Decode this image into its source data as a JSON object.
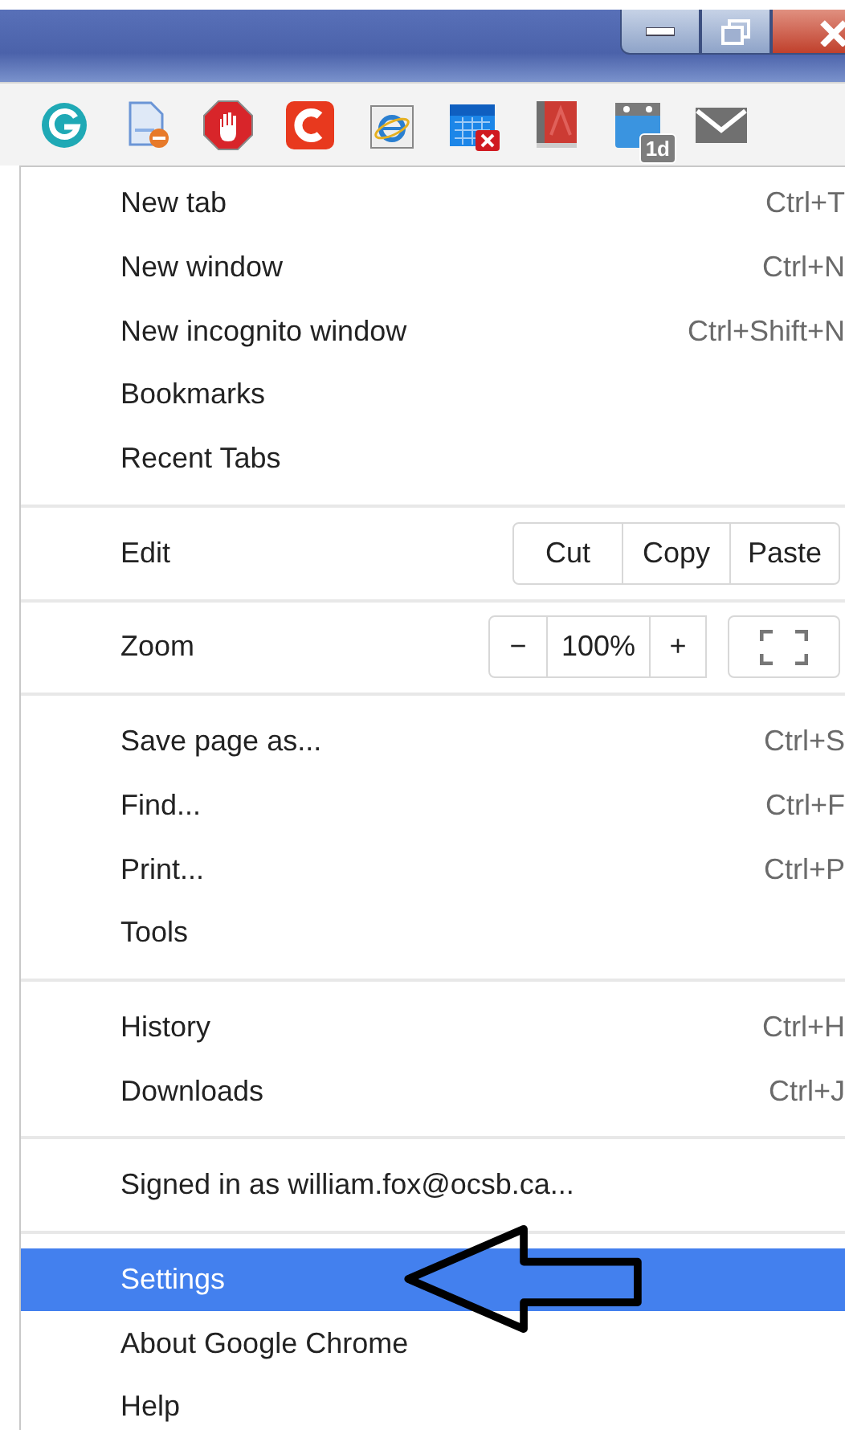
{
  "toolbar": {
    "calendar_badge": "1d"
  },
  "menu": {
    "sections": [
      {
        "items": [
          {
            "kind": "item",
            "label": "New tab",
            "shortcut": "Ctrl+T",
            "selected": false
          },
          {
            "kind": "item",
            "label": "New window",
            "shortcut": "Ctrl+N",
            "selected": false
          },
          {
            "kind": "item",
            "label": "New incognito window",
            "shortcut": "Ctrl+Shift+N",
            "selected": false
          },
          {
            "kind": "item",
            "label": "Bookmarks",
            "selected": false
          },
          {
            "kind": "item",
            "label": "Recent Tabs",
            "selected": false
          }
        ]
      },
      {
        "items": [
          {
            "kind": "edit",
            "label": "Edit",
            "buttons": [
              "Cut",
              "Copy",
              "Paste"
            ],
            "selected": false
          }
        ]
      },
      {
        "items": [
          {
            "kind": "zoom",
            "label": "Zoom",
            "minus": "−",
            "value": "100%",
            "plus": "+",
            "selected": false
          }
        ]
      },
      {
        "items": [
          {
            "kind": "item",
            "label": "Save page as...",
            "shortcut": "Ctrl+S",
            "selected": false
          },
          {
            "kind": "item",
            "label": "Find...",
            "shortcut": "Ctrl+F",
            "selected": false
          },
          {
            "kind": "item",
            "label": "Print...",
            "shortcut": "Ctrl+P",
            "selected": false
          },
          {
            "kind": "item",
            "label": "Tools",
            "selected": false
          }
        ]
      },
      {
        "items": [
          {
            "kind": "item",
            "label": "History",
            "shortcut": "Ctrl+H",
            "selected": false
          },
          {
            "kind": "item",
            "label": "Downloads",
            "shortcut": "Ctrl+J",
            "selected": false
          }
        ]
      },
      {
        "items": [
          {
            "kind": "item",
            "label": "Signed in as william.fox@ocsb.ca...",
            "selected": false
          }
        ]
      },
      {
        "items": [
          {
            "kind": "item",
            "label": "Settings",
            "selected": true
          },
          {
            "kind": "item",
            "label": "About Google Chrome",
            "selected": false
          },
          {
            "kind": "item",
            "label": "Help",
            "selected": false
          }
        ]
      }
    ]
  }
}
